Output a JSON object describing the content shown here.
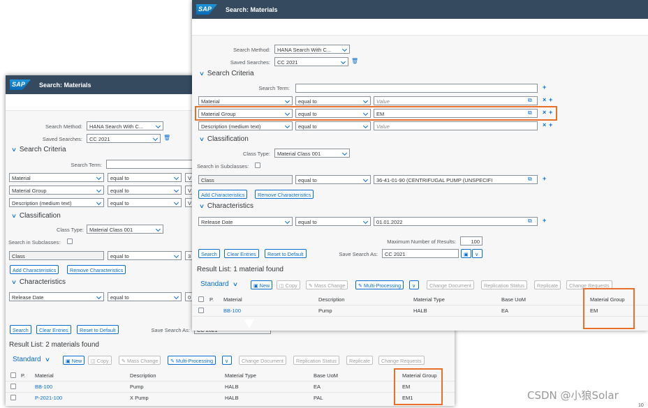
{
  "back": {
    "app_title": "Search: Materials",
    "logo_text": "SAP",
    "search_method_label": "Search Method:",
    "search_method_value": "HANA Search With C...",
    "saved_searches_label": "Saved Searches:",
    "saved_searches_value": "CC 2021",
    "search_criteria_title": "Search Criteria",
    "search_term_label": "Search Term:",
    "criteria_rows": [
      {
        "field": "Material",
        "operator": "equal to",
        "value": "V"
      },
      {
        "field": "Material Group",
        "operator": "equal to",
        "value": "V"
      },
      {
        "field": "Description (medium text)",
        "operator": "equal to",
        "value": "V"
      }
    ],
    "classification_title": "Classification",
    "class_type_label": "Class Type:",
    "class_type_value": "Material Class 001",
    "search_in_subclasses_label": "Search in Subclasses:",
    "class_row": {
      "field": "Class",
      "operator": "equal to",
      "value": "3"
    },
    "add_characteristics": "Add Characteristics",
    "remove_characteristics": "Remove Characteristics",
    "characteristics_title": "Characteristics",
    "char_row": {
      "field": "Release Date",
      "operator": "equal to",
      "value": "0"
    },
    "search_btn": "Search",
    "clear_btn": "Clear Entries",
    "reset_btn": "Reset to Default",
    "save_search_as_label": "Save Search As:",
    "save_search_as_value": "CC 2021",
    "result_label": "Result List: 2 materials found",
    "toolbar": {
      "standard": "Standard",
      "new": "New",
      "copy": "Copy",
      "mass_change": "Mass Change",
      "multi_processing": "Multi-Processing",
      "change_document": "Change Document",
      "replication_status": "Replication Status",
      "replicate": "Replicate",
      "change_requests": "Change Requests"
    },
    "columns": [
      "P.",
      "Material",
      "Description",
      "Material Type",
      "Base UoM",
      "Material Group"
    ],
    "rows": [
      {
        "material": "BB-100",
        "description": "Pump",
        "type": "HALB",
        "uom": "EA",
        "group": "EM"
      },
      {
        "material": "P-2021-100",
        "description": "X Pump",
        "type": "HALB",
        "uom": "PAL",
        "group": "EM1"
      }
    ]
  },
  "front": {
    "app_title": "Search: Materials",
    "logo_text": "SAP",
    "search_method_label": "Search Method:",
    "search_method_value": "HANA Search With C...",
    "saved_searches_label": "Saved Searches:",
    "saved_searches_value": "CC 2021",
    "search_criteria_title": "Search Criteria",
    "search_term_label": "Search Term:",
    "criteria_rows": [
      {
        "field": "Material",
        "operator": "equal to",
        "value": "Value",
        "placeholder": true
      },
      {
        "field": "Material Group",
        "operator": "equal to",
        "value": "EM",
        "placeholder": false
      },
      {
        "field": "Description (medium text)",
        "operator": "equal to",
        "value": "Value",
        "placeholder": true
      }
    ],
    "classification_title": "Classification",
    "class_type_label": "Class Type:",
    "class_type_value": "Material Class 001",
    "search_in_subclasses_label": "Search in Subclasses:",
    "class_row": {
      "field": "Class",
      "operator": "equal to",
      "value": "36-41-01-90 (CENTRIFUGAL PUMP (UNSPECIFI"
    },
    "add_characteristics": "Add Characteristics",
    "remove_characteristics": "Remove Characteristics",
    "characteristics_title": "Characteristics",
    "char_row": {
      "field": "Release Date",
      "operator": "equal to",
      "value": "01.01.2022"
    },
    "max_results_label": "Maximum Number of Results:",
    "max_results_value": "100",
    "search_btn": "Search",
    "clear_btn": "Clear Entries",
    "reset_btn": "Reset to Default",
    "save_search_as_label": "Save Search As:",
    "save_search_as_value": "CC 2021",
    "result_label": "Result List: 1 material found",
    "toolbar": {
      "standard": "Standard",
      "new": "New",
      "copy": "Copy",
      "mass_change": "Mass Change",
      "multi_processing": "Multi-Processing",
      "change_document": "Change Document",
      "replication_status": "Replication Status",
      "replicate": "Replicate",
      "change_requests": "Change Requests"
    },
    "columns": [
      "P.",
      "Material",
      "Description",
      "Material Type",
      "Base UoM",
      "Material Group"
    ],
    "rows": [
      {
        "material": "BB-100",
        "description": "Pump",
        "type": "HALB",
        "uom": "EA",
        "group": "EM"
      }
    ]
  },
  "watermark": "CSDN @小狼Solar",
  "corner_text": "10",
  "colors": {
    "shell": "#354a5f",
    "accent": "#0a6ed1",
    "highlight": "#e8702a"
  }
}
